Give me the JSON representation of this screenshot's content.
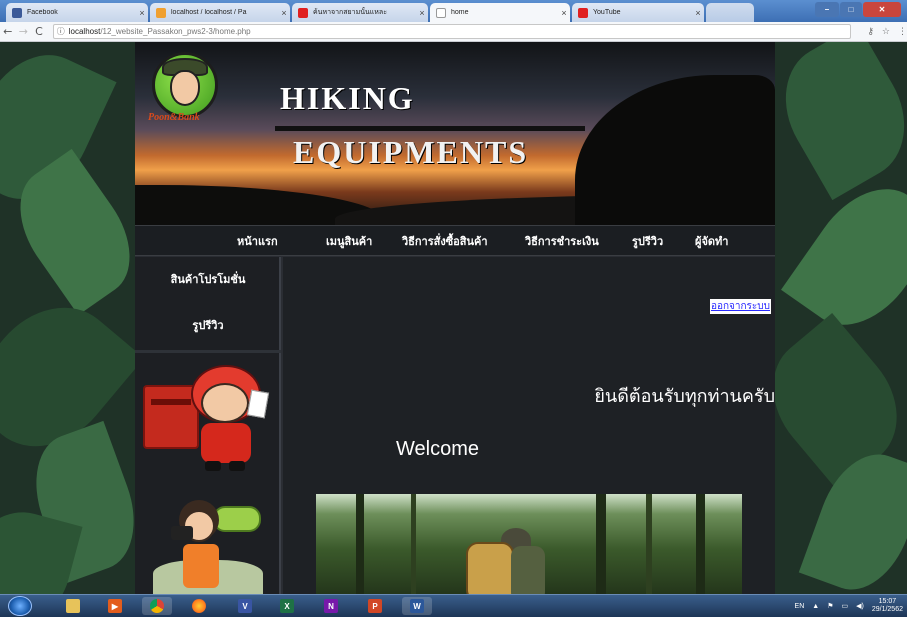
{
  "browser": {
    "tabs": [
      {
        "label": "Facebook",
        "favicon_color": "#3b5998"
      },
      {
        "label": "localhost / localhost / Pa",
        "favicon_color": "#f0a030"
      },
      {
        "label": "ค้นหาจากสยามนั้นแหละ",
        "favicon_color": "#e02020"
      },
      {
        "label": "home",
        "favicon_color": "#ffffff"
      },
      {
        "label": "YouTube",
        "favicon_color": "#e02020"
      }
    ],
    "active_tab": 3,
    "address": {
      "host": "localhost",
      "path": "/12_website_Passakon_pws2-3/home.php"
    },
    "window_controls": [
      "–",
      "□",
      "✕"
    ]
  },
  "site": {
    "logo_text": "Poon&Bank",
    "title_line1": "HIKING",
    "title_line2": "EQUIPMENTS",
    "menu": [
      "หน้าแรก",
      "เมนูสินค้า",
      "วิธีการสั่งซื้อสินค้า",
      "วิธีการชำระเงิน",
      "รูปรีวิว",
      "ผู้จัดทำ"
    ],
    "sidebar": [
      "สินค้าโปรโมชั่น",
      "รูปรีวิว"
    ],
    "logout": "ออกจากระบบ",
    "welcome_th": "ยินดีต้อนรับทุกท่านครับ",
    "welcome_en": "Welcome"
  },
  "taskbar": {
    "apps": [
      {
        "icon": "folder-icon",
        "label": "",
        "color": "#e7c35a"
      },
      {
        "icon": "media-player-icon",
        "label": "",
        "color": "#e35d1d"
      },
      {
        "icon": "chrome-icon",
        "label": "",
        "color": "#4caf50"
      },
      {
        "icon": "firefox-icon",
        "label": "",
        "color": "#ff7f1f"
      },
      {
        "icon": "visio-icon",
        "label": "V",
        "color": "#3955a3"
      },
      {
        "icon": "excel-icon",
        "label": "X",
        "color": "#1e7145"
      },
      {
        "icon": "onenote-icon",
        "label": "N",
        "color": "#7719aa"
      },
      {
        "icon": "powerpoint-icon",
        "label": "P",
        "color": "#d24726"
      },
      {
        "icon": "word-icon",
        "label": "W",
        "color": "#2b579a"
      }
    ],
    "tray": {
      "lang": "EN",
      "time": "15:07",
      "date": "29/1/2562"
    }
  }
}
